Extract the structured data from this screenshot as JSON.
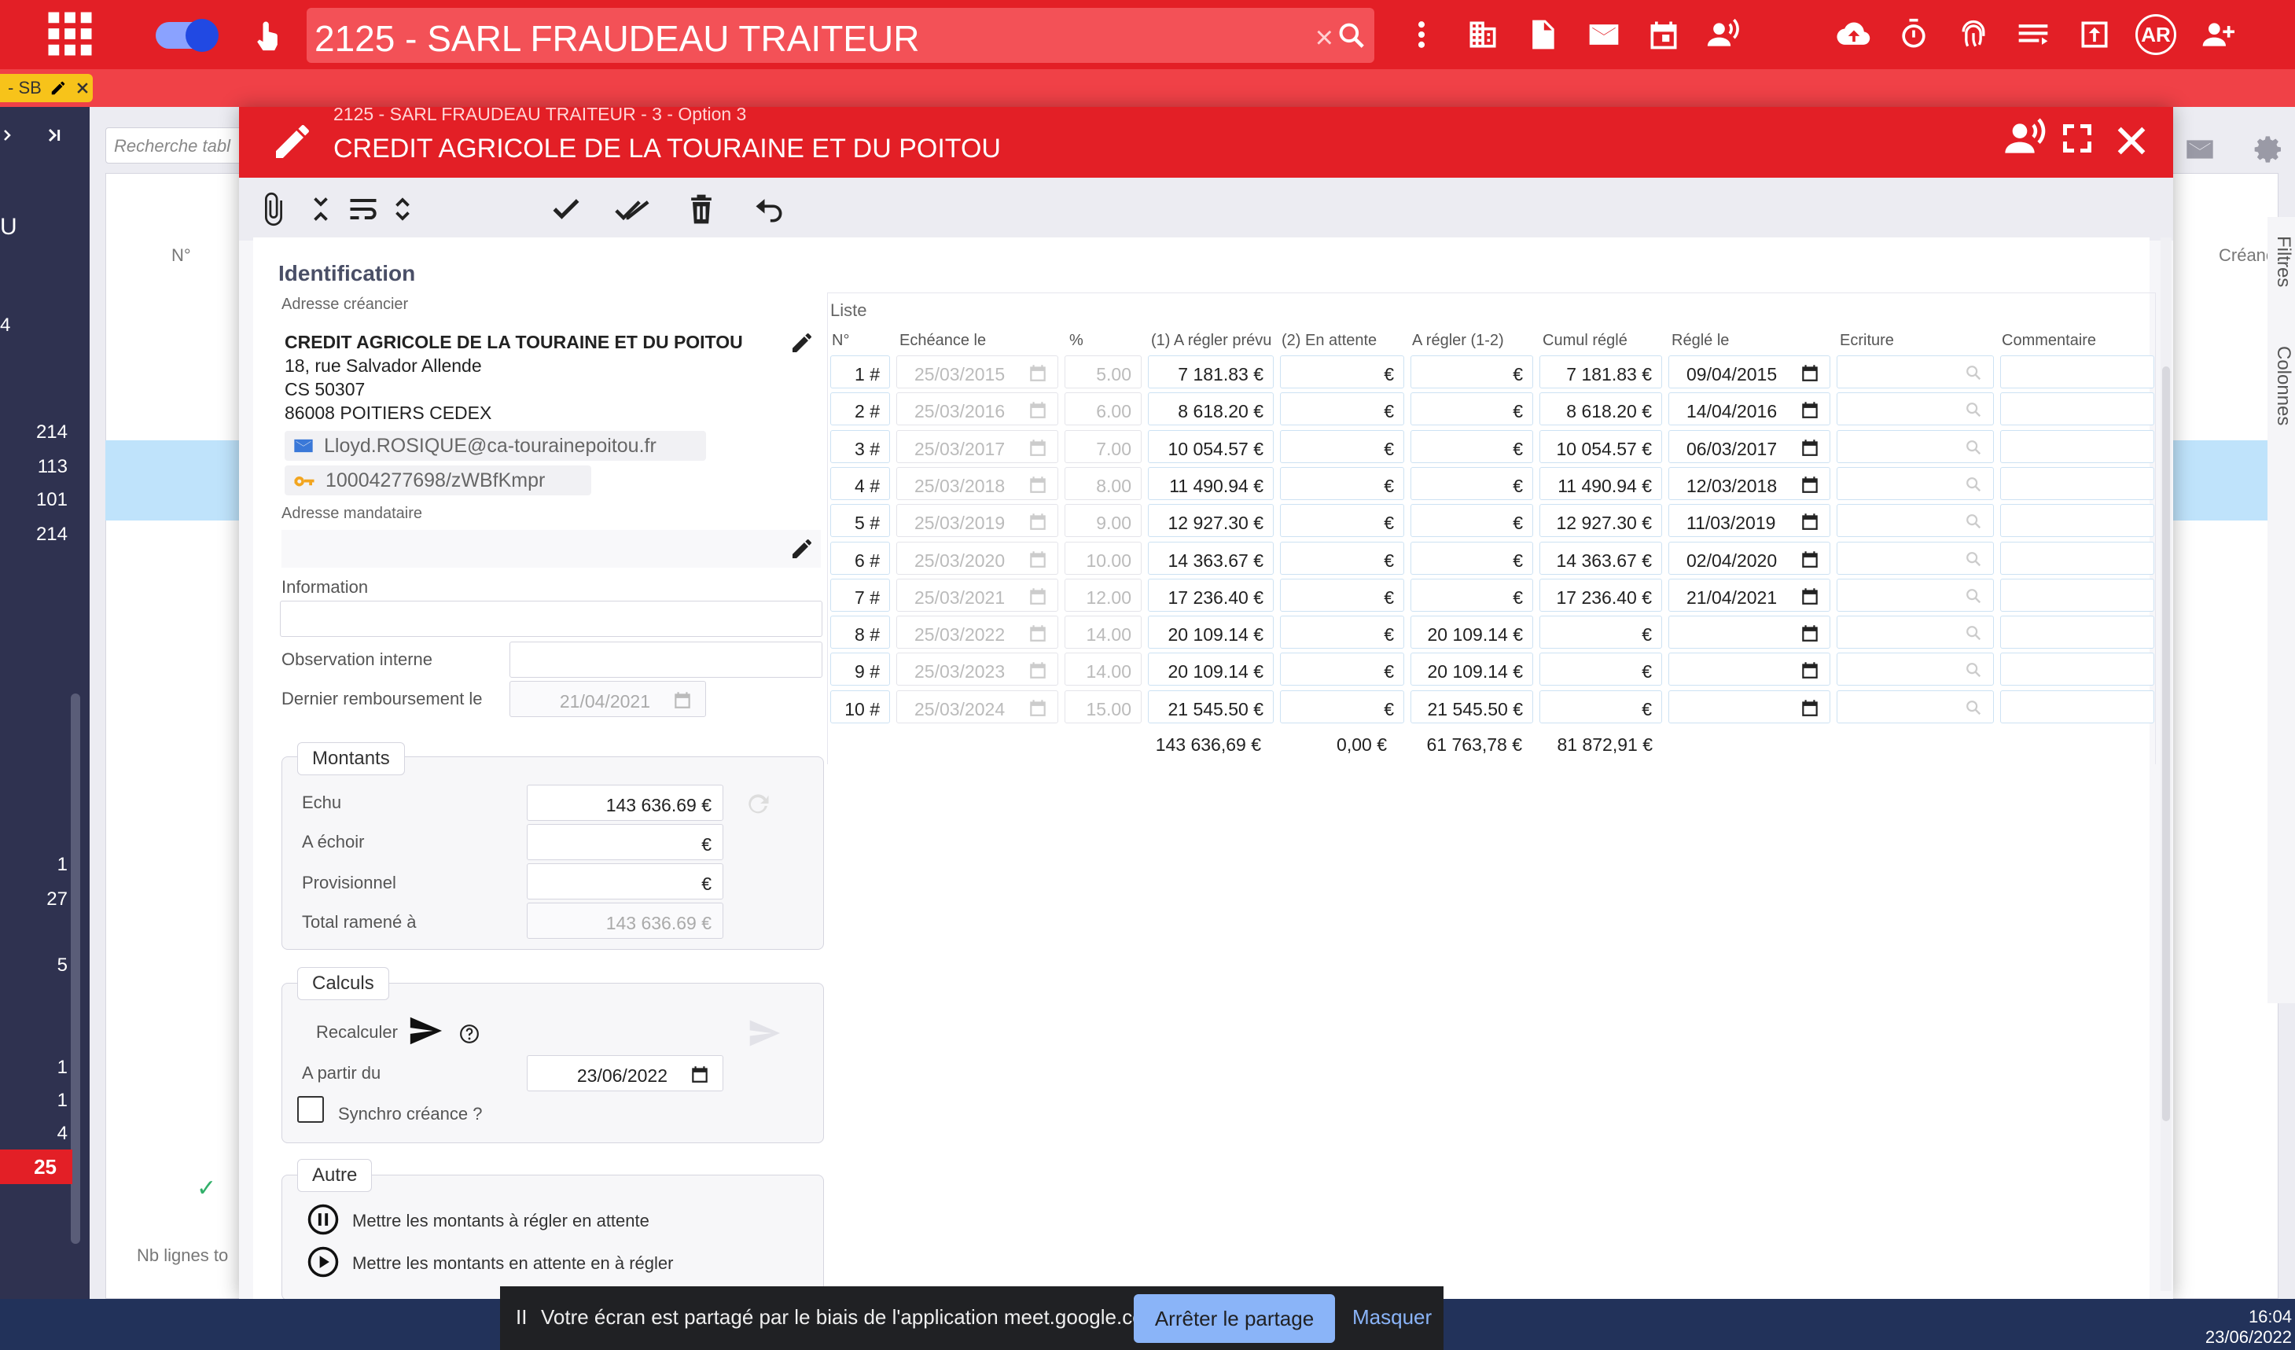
{
  "topbar": {
    "search_value": "2125 - SARL FRAUDEAU TRAITEUR",
    "clear_glyph": "×",
    "avatar_initials": "AR",
    "icons": [
      "apps-grid-icon",
      "toggle-switch",
      "touch-icon",
      "more-vert-icon",
      "building-icon",
      "document-icon",
      "mail-icon",
      "calendar-icon",
      "voice-icon",
      "cloud-upload-icon",
      "timer-icon",
      "fingerprint-icon",
      "list-icon",
      "upload-box-icon",
      "user-add-icon"
    ]
  },
  "subbar": {
    "tag": "- SB"
  },
  "sidebar": {
    "numbers": [
      "U",
      "4",
      "214",
      "113",
      "101",
      "214",
      "1",
      "27",
      "5",
      "1",
      "1",
      "4"
    ],
    "badge": "25"
  },
  "background": {
    "search_placeholder": "Recherche tabl",
    "col_no": "N°",
    "col_creance": "Créanc",
    "footer": "Nb lignes to",
    "filters": "Filtres",
    "columns": "Colonnes"
  },
  "modal": {
    "subtitle": "2125 - SARL FRAUDEAU TRAITEUR - 3 - Option 3",
    "title": "CREDIT AGRICOLE DE LA TOURAINE ET DU POITOU",
    "identification": {
      "section_title": "Identification",
      "creditor_label": "Adresse créancier",
      "creditor_name": "CREDIT AGRICOLE DE LA TOURAINE ET DU POITOU",
      "address_lines": [
        "18, rue Salvador Allende",
        "CS 50307",
        "86008 POITIERS CEDEX"
      ],
      "email": "Lloyd.ROSIQUE@ca-tourainepoitou.fr",
      "account": "10004277698/zWBfKmpr",
      "mandataire_label": "Adresse mandataire",
      "information_label": "Information",
      "observation_label": "Observation interne",
      "last_refund_label": "Dernier remboursement le",
      "last_refund_value": "21/04/2021"
    },
    "montants": {
      "title": "Montants",
      "echu_label": "Echu",
      "echu_value": "143 636.69 €",
      "a_echoir_label": "A échoir",
      "a_echoir_value": "€",
      "provisionnel_label": "Provisionnel",
      "provisionnel_value": "€",
      "total_label": "Total ramené à",
      "total_value": "143 636.69 €"
    },
    "calculs": {
      "title": "Calculs",
      "recalc_label": "Recalculer",
      "from_label": "A partir du",
      "from_value": "23/06/2022",
      "synchro_label": "Synchro créance ?"
    },
    "autre": {
      "title": "Autre",
      "opt1": "Mettre les montants à régler en attente",
      "opt2": "Mettre les montants en attente en à régler"
    },
    "grid": {
      "label": "Liste",
      "headers": [
        "N°",
        "Echéance le",
        "%",
        "(1) A régler prévu",
        "(2) En attente",
        "A régler (1-2)",
        "Cumul réglé",
        "Réglé le",
        "Ecriture",
        "Commentaire"
      ],
      "rows": [
        {
          "n": "1 #",
          "date": "25/03/2015",
          "pct": "5.00",
          "prevu": "7 181.83 €",
          "attente": "€",
          "regler": "€",
          "cumul": "7 181.83 €",
          "regle_le": "09/04/2015"
        },
        {
          "n": "2 #",
          "date": "25/03/2016",
          "pct": "6.00",
          "prevu": "8 618.20 €",
          "attente": "€",
          "regler": "€",
          "cumul": "8 618.20 €",
          "regle_le": "14/04/2016"
        },
        {
          "n": "3 #",
          "date": "25/03/2017",
          "pct": "7.00",
          "prevu": "10 054.57 €",
          "attente": "€",
          "regler": "€",
          "cumul": "10 054.57 €",
          "regle_le": "06/03/2017"
        },
        {
          "n": "4 #",
          "date": "25/03/2018",
          "pct": "8.00",
          "prevu": "11 490.94 €",
          "attente": "€",
          "regler": "€",
          "cumul": "11 490.94 €",
          "regle_le": "12/03/2018"
        },
        {
          "n": "5 #",
          "date": "25/03/2019",
          "pct": "9.00",
          "prevu": "12 927.30 €",
          "attente": "€",
          "regler": "€",
          "cumul": "12 927.30 €",
          "regle_le": "11/03/2019"
        },
        {
          "n": "6 #",
          "date": "25/03/2020",
          "pct": "10.00",
          "prevu": "14 363.67 €",
          "attente": "€",
          "regler": "€",
          "cumul": "14 363.67 €",
          "regle_le": "02/04/2020"
        },
        {
          "n": "7 #",
          "date": "25/03/2021",
          "pct": "12.00",
          "prevu": "17 236.40 €",
          "attente": "€",
          "regler": "€",
          "cumul": "17 236.40 €",
          "regle_le": "21/04/2021"
        },
        {
          "n": "8 #",
          "date": "25/03/2022",
          "pct": "14.00",
          "prevu": "20 109.14 €",
          "attente": "€",
          "regler": "20 109.14 €",
          "cumul": "€",
          "regle_le": ""
        },
        {
          "n": "9 #",
          "date": "25/03/2023",
          "pct": "14.00",
          "prevu": "20 109.14 €",
          "attente": "€",
          "regler": "20 109.14 €",
          "cumul": "€",
          "regle_le": ""
        },
        {
          "n": "10 #",
          "date": "25/03/2024",
          "pct": "15.00",
          "prevu": "21 545.50 €",
          "attente": "€",
          "regler": "21 545.50 €",
          "cumul": "€",
          "regle_le": ""
        }
      ],
      "totals": {
        "prevu": "143 636,69 €",
        "attente": "0,00 €",
        "regler": "61 763,78 €",
        "cumul": "81 872,91 €"
      }
    }
  },
  "share": {
    "pause": "II",
    "text": "Votre écran est partagé par le biais de l'application meet.google.com.",
    "stop": "Arrêter le partage",
    "hide": "Masquer"
  },
  "clock": {
    "time": "16:04",
    "date": "23/06/2022"
  }
}
